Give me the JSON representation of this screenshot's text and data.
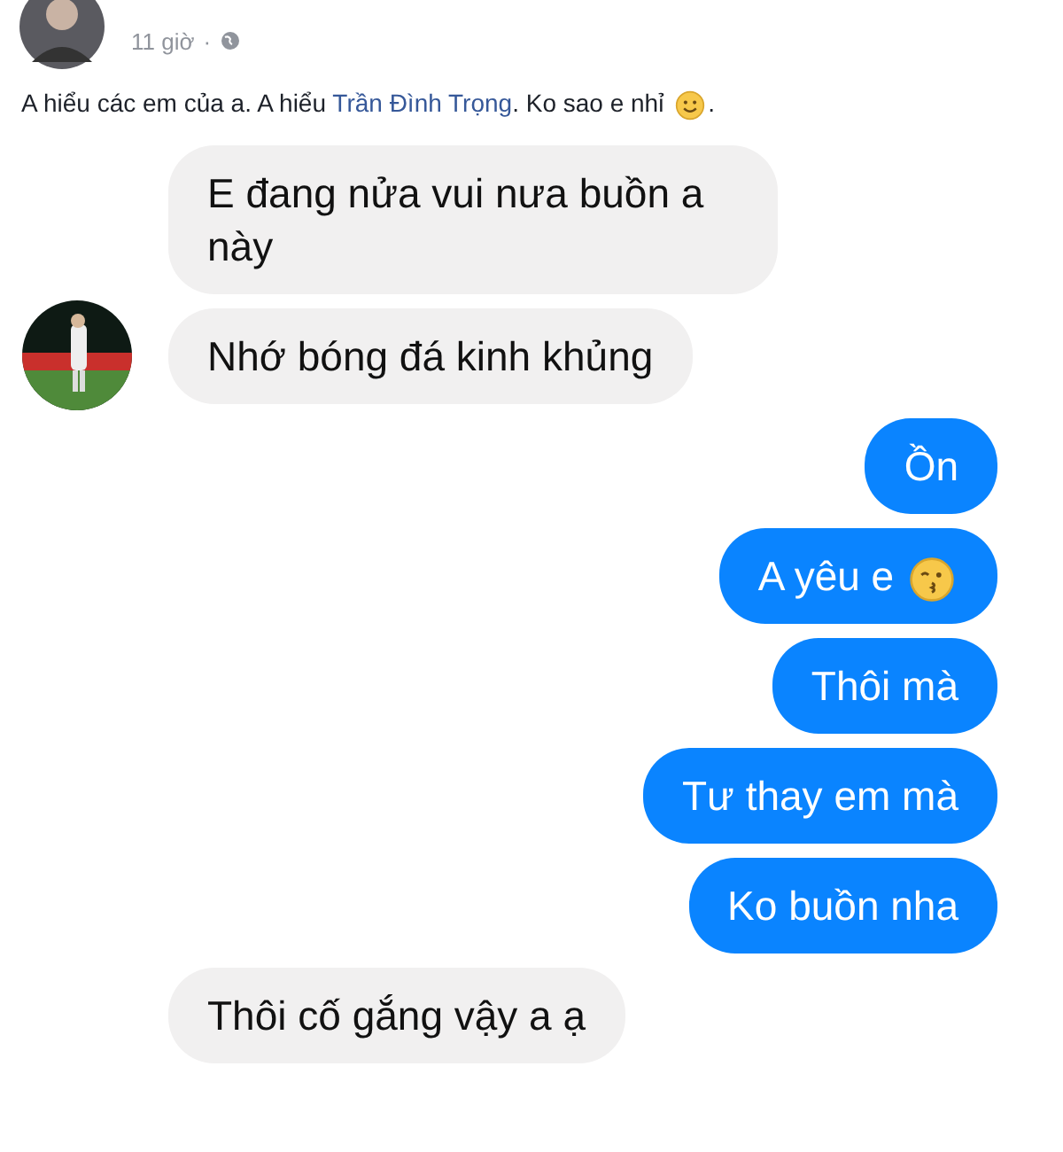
{
  "post": {
    "time": "11 giờ",
    "separator": "·",
    "text_before": "A hiểu các em của a. A hiểu ",
    "mention": "Trần Đình Trọng",
    "text_after": ". Ko sao e nhỉ ",
    "emoji": {
      "kind": "smile"
    },
    "text_end": "."
  },
  "messages": [
    {
      "kind": "received",
      "text": "E đang nửa vui nưa buồn a này",
      "avatar": false
    },
    {
      "kind": "received",
      "text": "Nhớ bóng đá kinh khủng",
      "avatar": true
    },
    {
      "kind": "sent",
      "text": "Ồn"
    },
    {
      "kind": "sent",
      "text": "A yêu e",
      "emoji": {
        "kind": "kiss"
      }
    },
    {
      "kind": "sent",
      "text": "Thôi mà"
    },
    {
      "kind": "sent",
      "text": "Tư thay em mà"
    },
    {
      "kind": "sent",
      "text": "Ko buồn nha"
    },
    {
      "kind": "received",
      "text": "Thôi cố gắng vậy a ạ",
      "avatar": false
    }
  ]
}
